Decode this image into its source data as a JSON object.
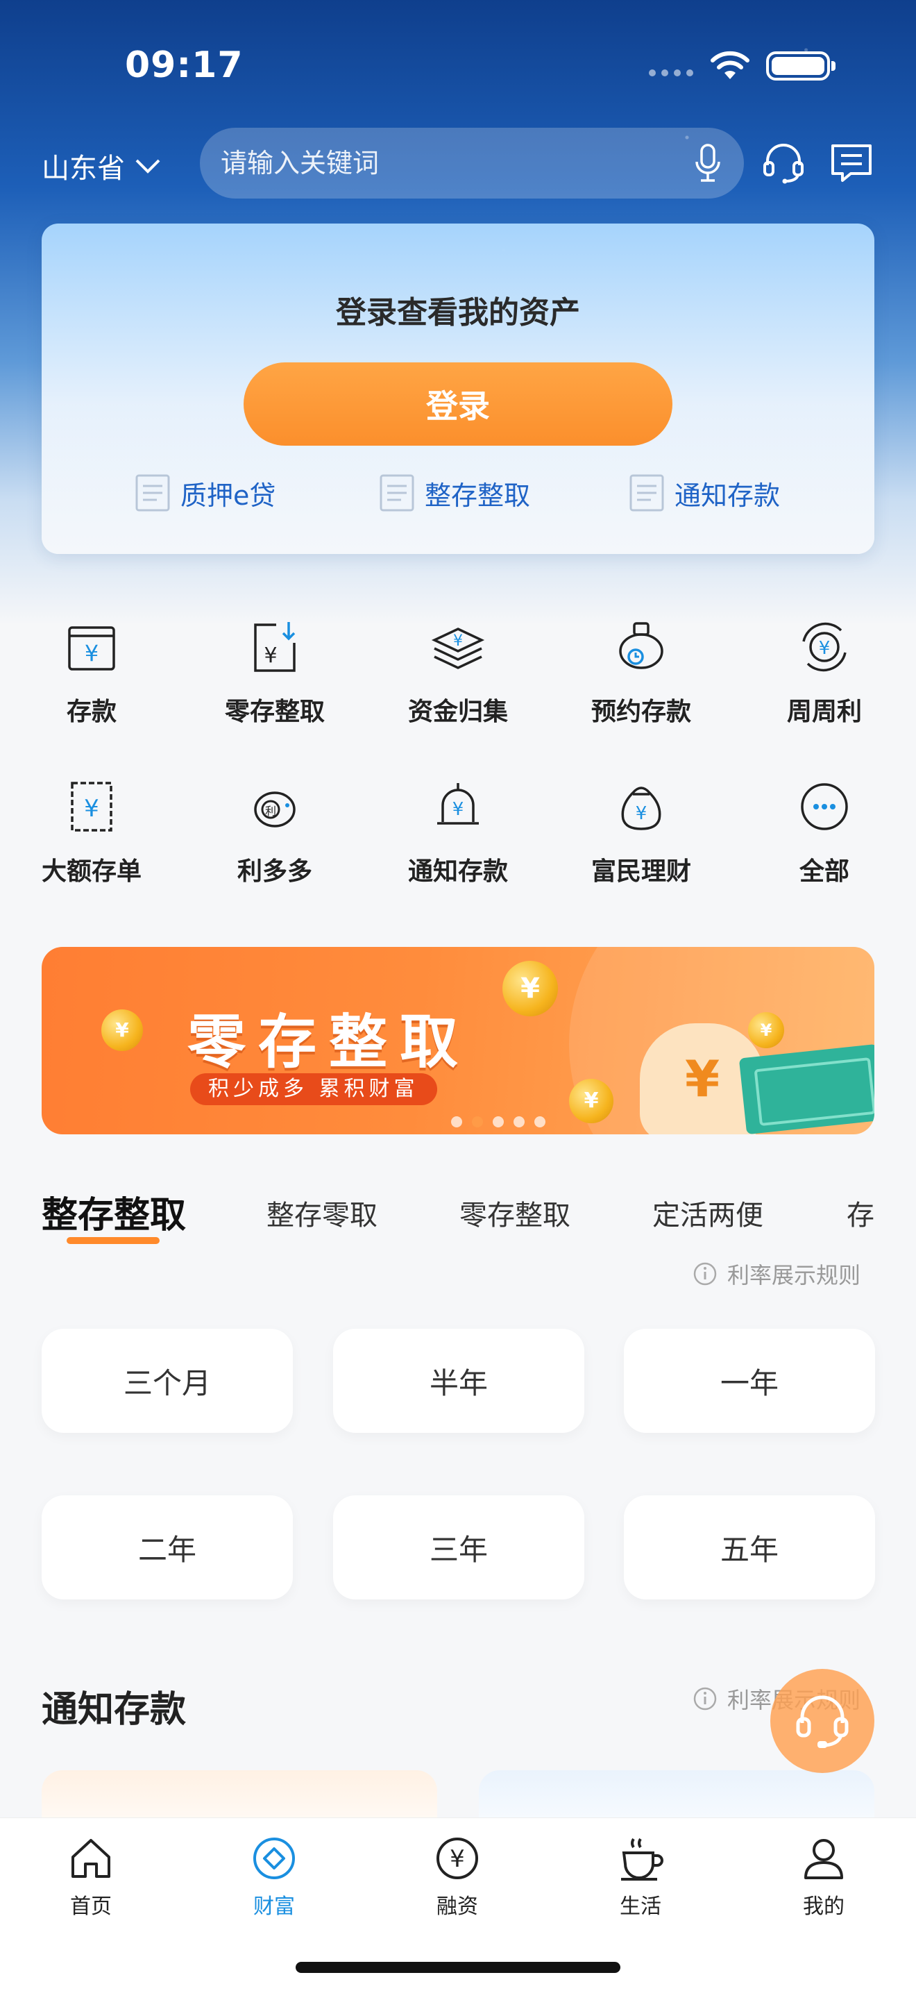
{
  "status_bar": {
    "time": "09:17"
  },
  "header": {
    "region": "山东省",
    "search_placeholder": "请输入关键词"
  },
  "login_card": {
    "title": "登录查看我的资产",
    "login_button": "登录",
    "quick_links": [
      "质押e贷",
      "整存整取",
      "通知存款"
    ]
  },
  "service_grid": [
    {
      "label": "存款",
      "icon": "deposit-icon"
    },
    {
      "label": "零存整取",
      "icon": "installment-deposit-icon"
    },
    {
      "label": "资金归集",
      "icon": "fund-collection-icon"
    },
    {
      "label": "预约存款",
      "icon": "appointment-deposit-icon"
    },
    {
      "label": "周周利",
      "icon": "weekly-interest-icon"
    },
    {
      "label": "大额存单",
      "icon": "large-cd-icon"
    },
    {
      "label": "利多多",
      "icon": "piggy-bank-icon"
    },
    {
      "label": "通知存款",
      "icon": "notice-deposit-icon"
    },
    {
      "label": "富民理财",
      "icon": "wealth-bag-icon"
    },
    {
      "label": "全部",
      "icon": "more-icon"
    }
  ],
  "banner": {
    "title": "零存整取",
    "subtitle": "积少成多  累积财富",
    "currency_symbol": "¥",
    "page_count": 5,
    "active_page": 2
  },
  "product_tabs": {
    "items": [
      "整存整取",
      "整存零取",
      "零存整取",
      "定活两便",
      "存"
    ],
    "active": "整存整取"
  },
  "rate_rule": "利率展示规则",
  "terms": [
    "三个月",
    "半年",
    "一年",
    "二年",
    "三年",
    "五年"
  ],
  "notice_section": {
    "title": "通知存款",
    "rate_rule": "利率展示规则"
  },
  "tab_bar": {
    "items": [
      {
        "label": "首页",
        "icon": "home-icon"
      },
      {
        "label": "财富",
        "icon": "wealth-icon"
      },
      {
        "label": "融资",
        "icon": "financing-icon"
      },
      {
        "label": "生活",
        "icon": "coffee-icon"
      },
      {
        "label": "我的",
        "icon": "profile-icon"
      }
    ],
    "active": "财富"
  },
  "colors": {
    "accent_orange": "#fb8f2c",
    "link_blue": "#1f63c6",
    "tab_active_blue": "#1a8fe0"
  }
}
